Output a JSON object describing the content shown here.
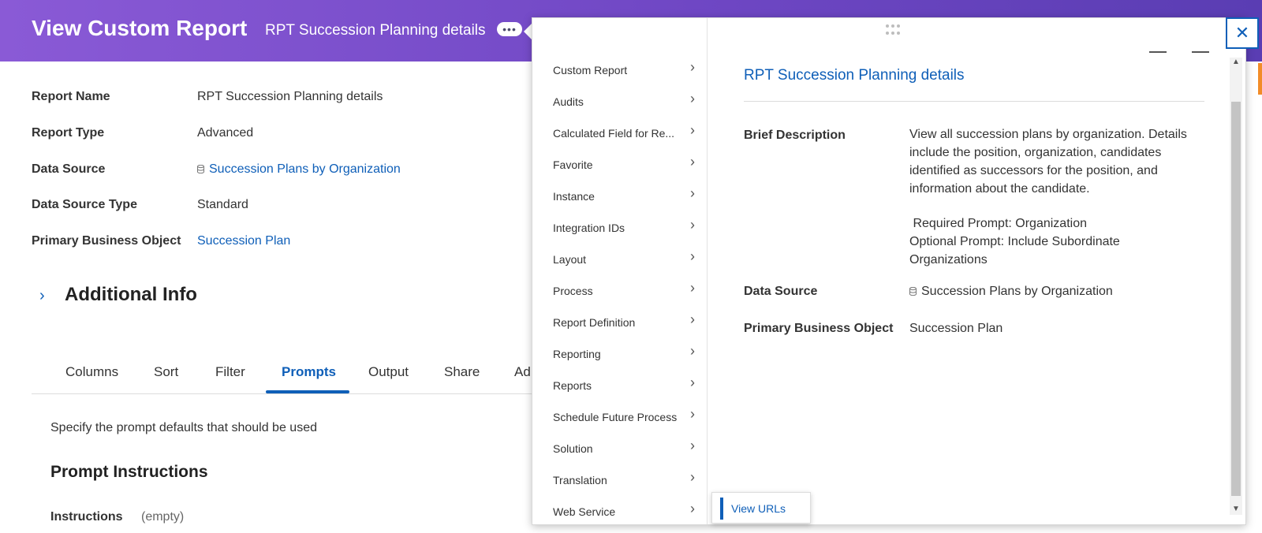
{
  "header": {
    "title": "View Custom Report",
    "subtitle": "RPT Succession Planning details",
    "related_actions_icon": "ellipsis-icon"
  },
  "fields": {
    "report_name": {
      "label": "Report Name",
      "value": "RPT Succession Planning details"
    },
    "report_type": {
      "label": "Report Type",
      "value": "Advanced"
    },
    "data_source": {
      "label": "Data Source",
      "value": "Succession Plans by Organization",
      "icon": "database-icon"
    },
    "data_source_type": {
      "label": "Data Source Type",
      "value": "Standard"
    },
    "primary_business_object": {
      "label": "Primary Business Object",
      "value": "Succession Plan"
    }
  },
  "additional_info": {
    "title": "Additional Info",
    "icon": "chevron-right-icon"
  },
  "tabs": [
    "Columns",
    "Sort",
    "Filter",
    "Prompts",
    "Output",
    "Share",
    "Ad"
  ],
  "active_tab": "Prompts",
  "prompts": {
    "description": "Specify the prompt defaults that should be used",
    "heading": "Prompt Instructions",
    "instructions_label": "Instructions",
    "instructions_value": "(empty)"
  },
  "menu": {
    "items": [
      "Custom Report",
      "Audits",
      "Calculated Field for Re...",
      "Favorite",
      "Instance",
      "Integration IDs",
      "Layout",
      "Process",
      "Report Definition",
      "Reporting",
      "Reports",
      "Schedule Future Process",
      "Solution",
      "Translation",
      "Web Service"
    ]
  },
  "detail": {
    "title": "RPT Succession Planning details",
    "brief_description_label": "Brief Description",
    "brief_description": [
      "View all succession plans by organization. Details",
      "include the position, organization, candidates",
      "identified as successors for the position, and",
      "information about the candidate.",
      "",
      " Required Prompt: Organization",
      "Optional Prompt: Include Subordinate",
      "Organizations"
    ],
    "data_source_label": "Data Source",
    "data_source_value": "Succession Plans by Organization",
    "primary_business_object_label": "Primary Business Object",
    "primary_business_object_value": "Succession Plan"
  },
  "flyout": {
    "label": "View URLs"
  },
  "controls": {
    "close_icon": "close-icon",
    "minimize_icon": "minimize-icon",
    "drag_icon": "drag-handle-icon"
  },
  "colors": {
    "header_start": "#8a5ad6",
    "header_end": "#5a3db3",
    "link": "#0f5fb8",
    "accent_orange": "#f28c28"
  }
}
